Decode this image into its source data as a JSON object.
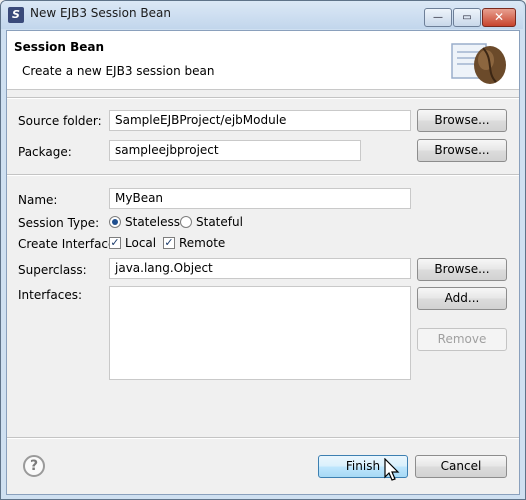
{
  "window": {
    "title": "New EJB3 Session Bean",
    "minimize": "—",
    "maximize": "▭",
    "close": "✕"
  },
  "header": {
    "title": "Session Bean",
    "description": "Create a new EJB3 session bean"
  },
  "form": {
    "source_folder": {
      "label": "Source folder:",
      "value": "SampleEJBProject/ejbModule",
      "button": "Browse..."
    },
    "package": {
      "label": "Package:",
      "value": "sampleejbproject",
      "button": "Browse..."
    },
    "name": {
      "label": "Name:",
      "value": "MyBean"
    },
    "session_type": {
      "label": "Session Type:",
      "options": [
        "Stateless",
        "Stateful"
      ],
      "selected": "Stateless"
    },
    "create_interface": {
      "label": "Create Interface:",
      "options": [
        {
          "label": "Local",
          "checked": true
        },
        {
          "label": "Remote",
          "checked": true
        }
      ]
    },
    "superclass": {
      "label": "Superclass:",
      "value": "java.lang.Object",
      "button": "Browse..."
    },
    "interfaces": {
      "label": "Interfaces:",
      "add_button": "Add...",
      "remove_button": "Remove"
    }
  },
  "footer": {
    "help": "?",
    "finish": "Finish",
    "cancel": "Cancel"
  },
  "icons": [
    "app-icon",
    "bean-icon",
    "help-icon",
    "cursor-icon"
  ]
}
